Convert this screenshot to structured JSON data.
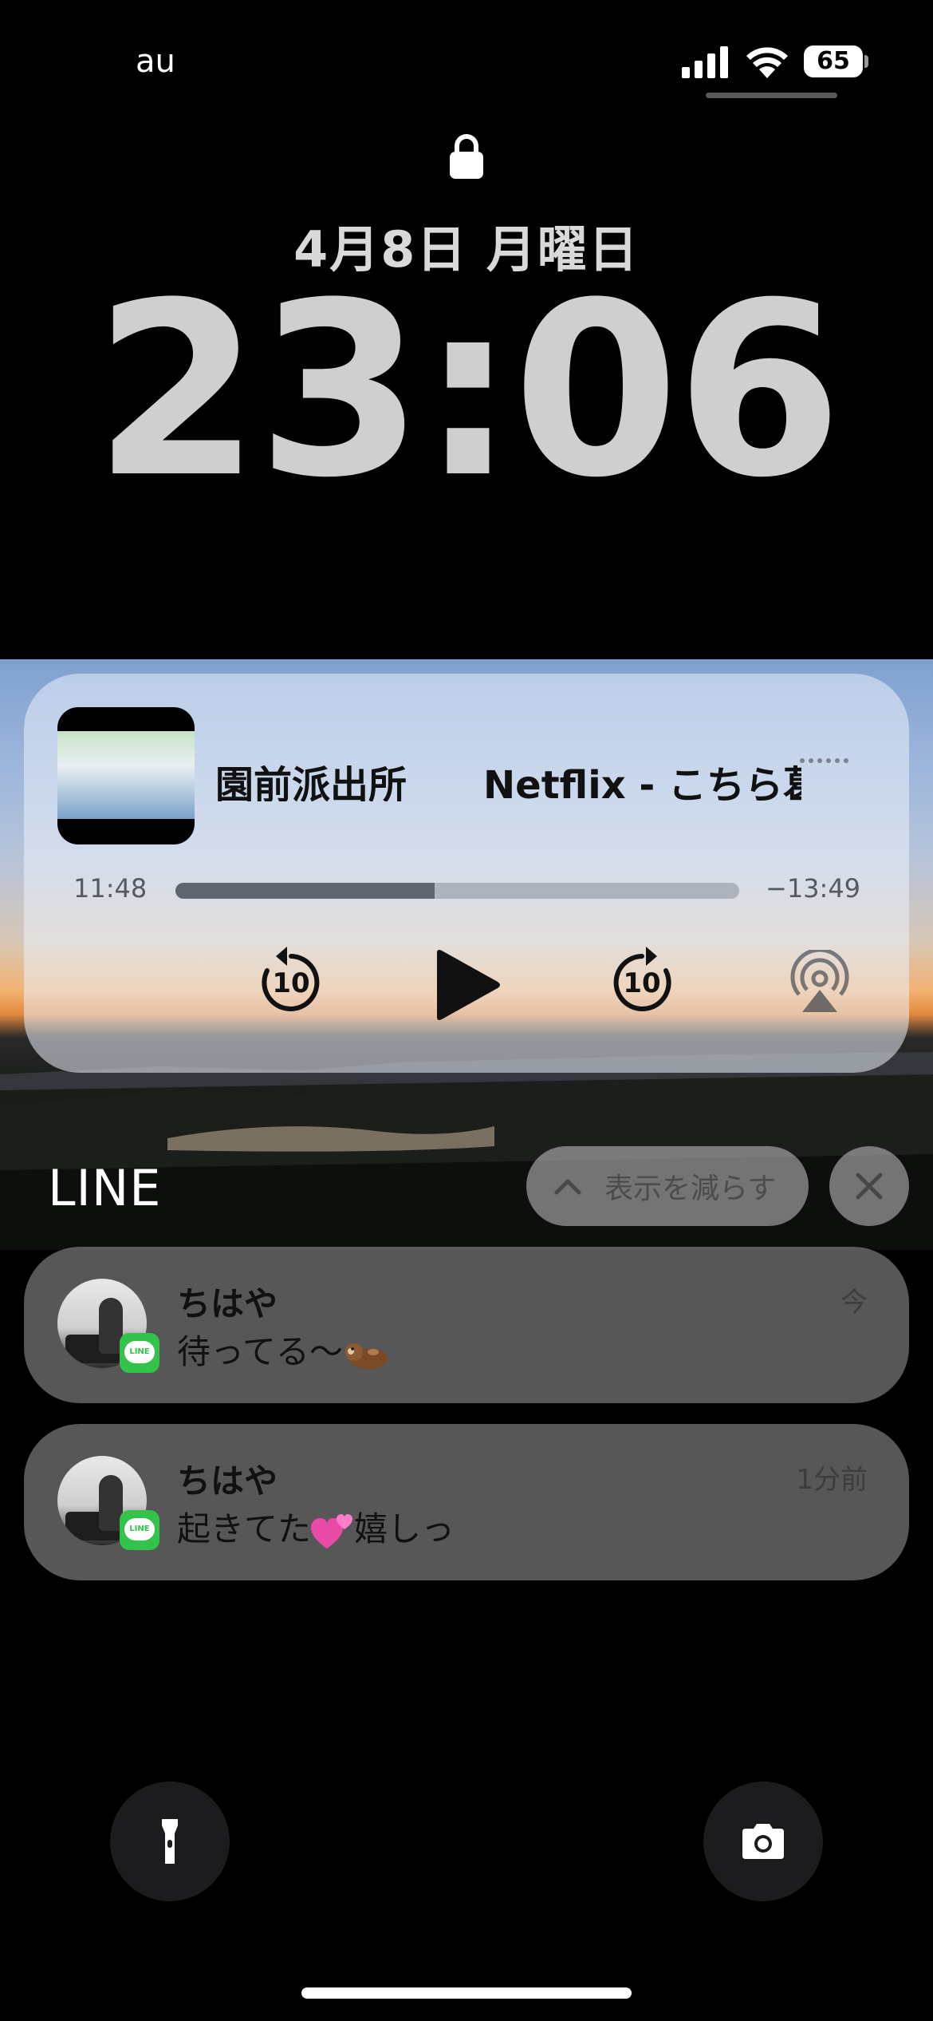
{
  "status_bar": {
    "carrier": "au",
    "battery_percent": "65",
    "signal_bars": 4,
    "wifi": true
  },
  "lock_screen": {
    "lock_icon": "lock-icon",
    "date": "4月8日 月曜日",
    "time": "23:06"
  },
  "now_playing": {
    "track_title": "園前派出所　　Netflix - こちら葛",
    "more_icon": "more-dots-icon",
    "elapsed": "11:48",
    "remaining": "−13:49",
    "progress_fraction": 0.46,
    "controls": {
      "skip_back_label": "10",
      "skip_forward_label": "10",
      "play_icon": "play-icon",
      "airplay_icon": "airplay-icon"
    }
  },
  "notification_group": {
    "app_name": "LINE",
    "show_less_label": "表示を減らす",
    "dismiss_icon": "close-icon"
  },
  "notifications": [
    {
      "sender": "ちはや",
      "message": "待ってる〜",
      "emoji": "otter-emoji",
      "time": "今"
    },
    {
      "sender": "ちはや",
      "message_before": "起きてた",
      "emoji": "two-hearts-emoji",
      "message_after": "嬉しっ",
      "time": "1分前"
    }
  ],
  "quick_actions": {
    "left_icon": "flashlight-icon",
    "right_icon": "camera-icon"
  },
  "colors": {
    "line_green": "#34c34a"
  }
}
